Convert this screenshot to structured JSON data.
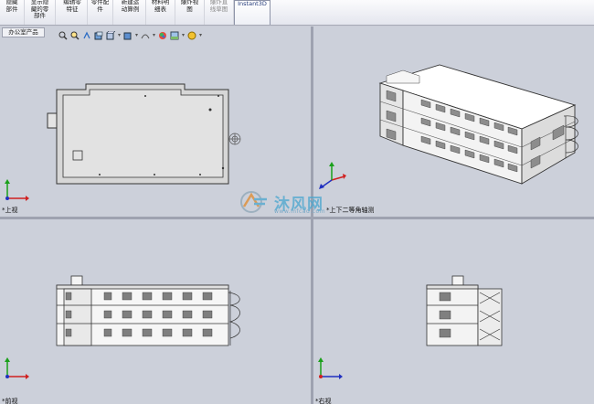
{
  "toolbar": {
    "buttons": [
      {
        "label": "隐藏\n部件",
        "state": "normal"
      },
      {
        "label": "显示隐\n藏的零\n部件",
        "state": "normal"
      },
      {
        "label": "编辑零\n特征",
        "state": "normal"
      },
      {
        "label": "零件配\n件",
        "state": "normal"
      },
      {
        "label": "新建运\n动算例",
        "state": "normal"
      },
      {
        "label": "材料明\n细表",
        "state": "normal"
      },
      {
        "label": "爆炸视\n图",
        "state": "normal"
      },
      {
        "label": "爆炸直\n线草图",
        "state": "disabled"
      },
      {
        "label": "Instant3D",
        "state": "active"
      }
    ]
  },
  "feature_tab": {
    "label": "办公室产品"
  },
  "view_toolbar": {
    "icons": [
      "zoom-to-fit-icon",
      "zoom-area-icon",
      "previous-view-icon",
      "section-view-icon",
      "view-orientation-icon",
      "display-style-icon",
      "hide-show-items-icon",
      "edit-appearance-icon",
      "apply-scene-icon",
      "view-settings-icon"
    ]
  },
  "viewports": {
    "top": {
      "label": "*上视"
    },
    "iso": {
      "label": "*上下二等角轴测"
    },
    "front": {
      "label": "*前视"
    },
    "right": {
      "label": "*右视"
    }
  },
  "watermark": {
    "text": "沐风网",
    "url": "www.mfcad.com"
  },
  "colors": {
    "background": "#ccd0da",
    "axis_x": "#d02020",
    "axis_y": "#1aa01a",
    "axis_z": "#2030c0",
    "accent": "#4aa6cf"
  }
}
